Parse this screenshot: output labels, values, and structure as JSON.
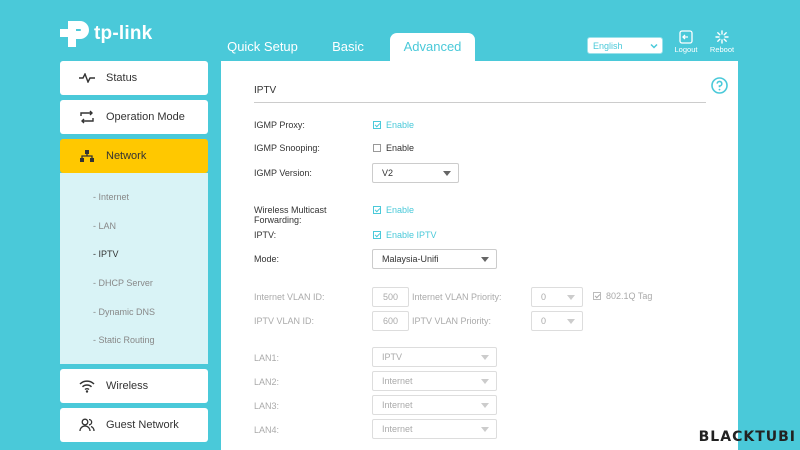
{
  "brand": {
    "name": "tp-link"
  },
  "nav": {
    "tabs": [
      {
        "label": "Quick Setup"
      },
      {
        "label": "Basic"
      },
      {
        "label": "Advanced"
      }
    ],
    "active_tab": "Advanced"
  },
  "header": {
    "language": "English",
    "logout_label": "Logout",
    "reboot_label": "Reboot"
  },
  "sidebar": {
    "items": [
      {
        "label": "Status",
        "icon": "pulse-icon"
      },
      {
        "label": "Operation Mode",
        "icon": "swap-icon"
      },
      {
        "label": "Network",
        "icon": "network-icon"
      },
      {
        "label": "Wireless",
        "icon": "wifi-icon"
      },
      {
        "label": "Guest Network",
        "icon": "users-icon"
      }
    ],
    "active_item": "Network",
    "subitems": [
      {
        "label": "- Internet"
      },
      {
        "label": "- LAN"
      },
      {
        "label": "- IPTV"
      },
      {
        "label": "- DHCP Server"
      },
      {
        "label": "- Dynamic DNS"
      },
      {
        "label": "- Static Routing"
      }
    ],
    "active_subitem": "- IPTV"
  },
  "iptv": {
    "section_title": "IPTV",
    "help_icon": "question-circle-icon",
    "igmp_proxy": {
      "label": "IGMP Proxy:",
      "option": "Enable",
      "checked": true
    },
    "igmp_snooping": {
      "label": "IGMP Snooping:",
      "option": "Enable",
      "checked": false
    },
    "igmp_version": {
      "label": "IGMP Version:",
      "value": "V2"
    },
    "wireless_multicast": {
      "label_line1": "Wireless Multicast",
      "label_line2": "Forwarding:",
      "option": "Enable",
      "checked": true
    },
    "iptv": {
      "label": "IPTV:",
      "option": "Enable IPTV",
      "checked": true
    },
    "mode": {
      "label": "Mode:",
      "value": "Malaysia-Unifi"
    },
    "internet_vlan_id": {
      "label": "Internet VLAN ID:",
      "value": "500"
    },
    "internet_vlan_priority": {
      "label": "Internet VLAN Priority:",
      "value": "0"
    },
    "tag_8021q": {
      "option": "802.1Q Tag",
      "checked": true
    },
    "iptv_vlan_id": {
      "label": "IPTV VLAN ID:",
      "value": "600"
    },
    "iptv_vlan_priority": {
      "label": "IPTV VLAN Priority:",
      "value": "0"
    },
    "lans": [
      {
        "label": "LAN1:",
        "value": "IPTV"
      },
      {
        "label": "LAN2:",
        "value": "Internet"
      },
      {
        "label": "LAN3:",
        "value": "Internet"
      },
      {
        "label": "LAN4:",
        "value": "Internet"
      }
    ]
  },
  "watermark": "BLACKTUBI",
  "colors": {
    "background": "#4ac9d9",
    "accent": "#4ac9d9",
    "active_sidebar": "#ffc800",
    "subpanel": "#d9f3f6"
  }
}
